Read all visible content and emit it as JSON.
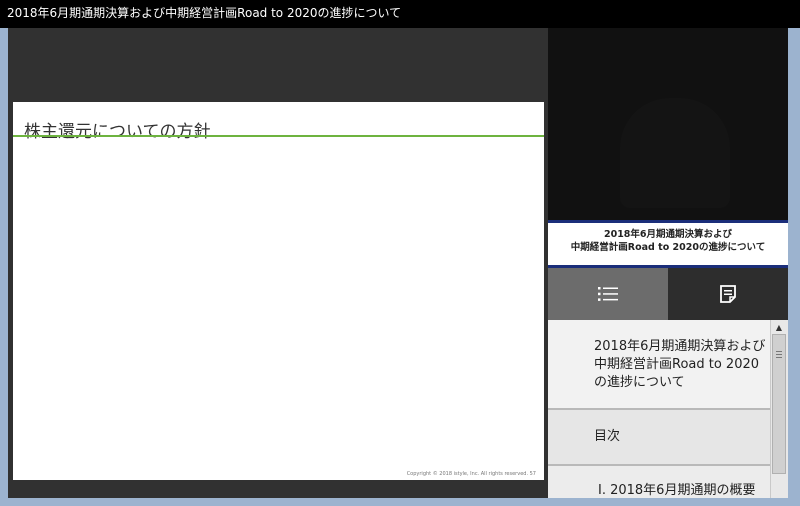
{
  "window": {
    "title": "2018年6月期通期決算および中期経営計画Road to 2020の進捗について"
  },
  "slide": {
    "title": "株主還元についての方針",
    "copyright": "Copyright © 2018 istyle, Inc. All rights reserved.",
    "page_number": "57"
  },
  "video": {
    "caption_line1": "2018年6月期通期決算および",
    "caption_line2": "中期経営計画Road to 2020の進捗について"
  },
  "tabs": [
    {
      "name": "list",
      "icon": "list-icon",
      "selected": true
    },
    {
      "name": "notes",
      "icon": "notes-icon",
      "selected": false
    }
  ],
  "toc": {
    "items": [
      {
        "label": "2018年6月期通期決算および中期経営計画Road to 2020の進捗について"
      },
      {
        "label": "目次"
      },
      {
        "label": "Ⅰ. 2018年6月期通期の概要"
      }
    ]
  },
  "colors": {
    "accent_rule": "#6db33f",
    "caption_border": "#1b2e7a",
    "frame": "#9cb3cf"
  }
}
